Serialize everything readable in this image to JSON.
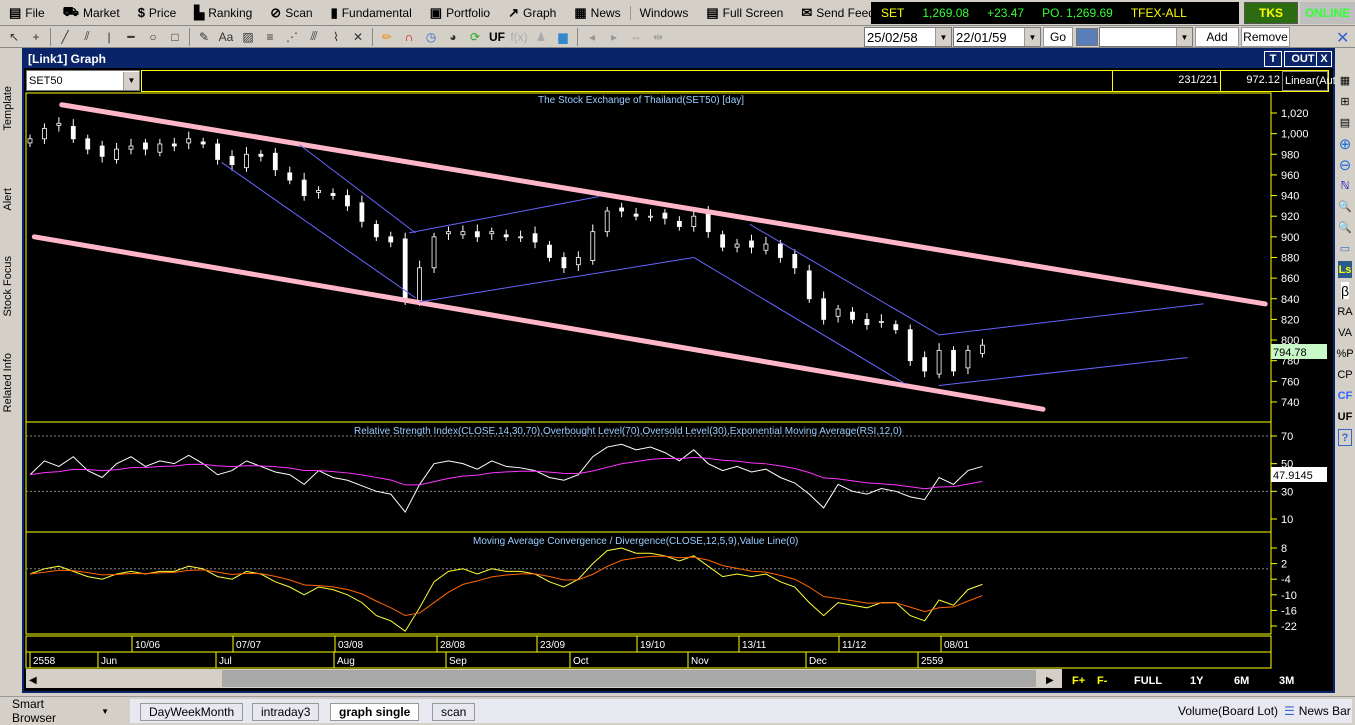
{
  "menu": [
    {
      "icon": "file-icon",
      "g": "▤",
      "label": "File"
    },
    {
      "icon": "market-icon",
      "g": "⛟",
      "label": "Market"
    },
    {
      "icon": "price-icon",
      "g": "$",
      "label": "Price"
    },
    {
      "icon": "ranking-icon",
      "g": "▙",
      "label": "Ranking"
    },
    {
      "icon": "scan-icon",
      "g": "⊘",
      "label": "Scan"
    },
    {
      "icon": "fundamental-icon",
      "g": "▮",
      "label": "Fundamental"
    },
    {
      "icon": "portfolio-icon",
      "g": "▣",
      "label": "Portfolio"
    },
    {
      "icon": "graph-icon",
      "g": "↗",
      "label": "Graph"
    },
    {
      "icon": "news-icon",
      "g": "▦",
      "label": "News"
    },
    {
      "icon": "",
      "g": "",
      "label": "Windows"
    },
    {
      "icon": "fullscreen-icon",
      "g": "▤",
      "label": "Full Screen"
    },
    {
      "icon": "feedback-icon",
      "g": "✉",
      "label": "Send Feedback"
    }
  ],
  "ticker": {
    "name": "SET",
    "value": "1,269.08",
    "change": "+23.47",
    "po": "PO. 1,269.69",
    "tfex": "TFEX-ALL",
    "colors": {
      "name": "#ffff00",
      "value": "#33ff33"
    }
  },
  "status": {
    "broker": "TKS",
    "connection": "ONLINE"
  },
  "toolbar": {
    "uf": "UF",
    "from_date": "25/02/58",
    "to_date": "22/01/59",
    "go": "Go",
    "add": "Add",
    "remove": "Remove"
  },
  "left_tabs": [
    "Template",
    "Alert",
    "Stock Focus",
    "Related Info"
  ],
  "window": {
    "title": "[Link1] Graph",
    "t_btn": "T",
    "out_btn": "OUT",
    "close_btn": "X"
  },
  "symbol": "SET50",
  "info": {
    "bars": "231/221",
    "price": "972.12",
    "scale": "Linear(Auto)"
  },
  "right_tools": [
    "RA",
    "VA",
    "%P",
    "CP",
    "CF",
    "UF"
  ],
  "chart_data": [
    {
      "type": "candlestick",
      "title": "The Stock Exchange of Thailand(SET50) [day]",
      "y_ticks": [
        "1,020",
        "1,000",
        "980",
        "960",
        "940",
        "920",
        "900",
        "880",
        "860",
        "840",
        "820",
        "800",
        "780",
        "760",
        "740"
      ],
      "ylim": [
        730,
        1030
      ],
      "last_value": "794.78",
      "close": [
        995,
        1005,
        1010,
        995,
        985,
        978,
        985,
        988,
        985,
        990,
        988,
        995,
        990,
        975,
        970,
        980,
        978,
        965,
        955,
        940,
        945,
        940,
        930,
        915,
        900,
        895,
        840,
        870,
        900,
        905,
        905,
        900,
        905,
        900,
        900,
        895,
        880,
        870,
        880,
        905,
        925,
        925,
        920,
        920,
        918,
        910,
        920,
        905,
        890,
        893,
        890,
        893,
        880,
        870,
        840,
        820,
        830,
        820,
        815,
        818,
        810,
        780,
        770,
        790,
        770,
        790,
        795
      ],
      "trendlines": [
        {
          "color": "#ffb6c8",
          "from": [
            2.2,
            1028
          ],
          "to": [
            85.6,
            835
          ]
        },
        {
          "color": "#ffb6c8",
          "from": [
            0.3,
            900
          ],
          "to": [
            70.2,
            733
          ]
        },
        {
          "color": "#6666ff",
          "from": [
            13.3,
            972
          ],
          "to": [
            26.7,
            841
          ]
        },
        {
          "color": "#6666ff",
          "from": [
            18.7,
            989
          ],
          "to": [
            26.7,
            904
          ]
        },
        {
          "color": "#6666ff",
          "from": [
            26.3,
            904
          ],
          "to": [
            39.4,
            939
          ]
        },
        {
          "color": "#6666ff",
          "from": [
            27,
            837
          ],
          "to": [
            46,
            880
          ]
        },
        {
          "color": "#6666ff",
          "from": [
            46,
            880
          ],
          "to": [
            60.6,
            758
          ]
        },
        {
          "color": "#6666ff",
          "from": [
            49.9,
            912
          ],
          "to": [
            63,
            805
          ]
        },
        {
          "color": "#6666ff",
          "from": [
            63,
            805
          ],
          "to": [
            81.3,
            835
          ]
        },
        {
          "color": "#6666ff",
          "from": [
            63,
            756
          ],
          "to": [
            80.2,
            783
          ]
        }
      ]
    },
    {
      "type": "line",
      "title": "Relative Strength Index(CLOSE,14,30,70),Overbought Level(70),Oversold Level(30),Exponential Moving Average(RSI,12,0)",
      "y_ticks": [
        "70",
        "50",
        "30",
        "10"
      ],
      "ylim": [
        0,
        80
      ],
      "levels": [
        70,
        30
      ],
      "last_value": "47.9145",
      "rsi": [
        42,
        52,
        48,
        55,
        45,
        40,
        50,
        55,
        48,
        52,
        50,
        56,
        50,
        42,
        45,
        52,
        48,
        44,
        42,
        35,
        45,
        40,
        38,
        34,
        30,
        28,
        15,
        35,
        50,
        52,
        50,
        46,
        52,
        48,
        47,
        45,
        40,
        38,
        42,
        55,
        62,
        64,
        60,
        62,
        58,
        52,
        60,
        50,
        45,
        48,
        44,
        46,
        40,
        36,
        28,
        18,
        35,
        30,
        28,
        32,
        30,
        26,
        24,
        40,
        35,
        45,
        48
      ],
      "colors": {
        "rsi": "#ffffff",
        "ema": "#ff33ff"
      }
    },
    {
      "type": "line",
      "title": "Moving Average Convergence / Divergence(CLOSE,12,5,9),Value Line(0)",
      "y_ticks": [
        "8",
        "2",
        "-4",
        "-10",
        "-16",
        "-22"
      ],
      "ylim": [
        -25,
        10
      ],
      "levels": [
        0
      ],
      "macd": [
        -2,
        0,
        1,
        -1,
        -3,
        -4,
        -2,
        -1,
        -2,
        -1,
        -1,
        1,
        0,
        -3,
        -4,
        -1,
        -2,
        -5,
        -7,
        -10,
        -7,
        -8,
        -10,
        -13,
        -18,
        -20,
        -24,
        -15,
        -5,
        -1,
        0,
        -2,
        0,
        -1,
        -1,
        -2,
        -5,
        -7,
        -4,
        2,
        7,
        8,
        6,
        6,
        5,
        3,
        5,
        1,
        -3,
        -2,
        -3,
        -2,
        -5,
        -7,
        -13,
        -18,
        -13,
        -14,
        -15,
        -13,
        -13,
        -18,
        -20,
        -12,
        -14,
        -8,
        -6
      ],
      "colors": {
        "macd": "#ffff33",
        "signal": "#ff6600"
      }
    }
  ],
  "x_axis": {
    "dates": [
      "10/06",
      "07/07",
      "03/08",
      "28/08",
      "23/09",
      "19/10",
      "13/11",
      "11/12",
      "08/01"
    ],
    "months": [
      "2558",
      "Jun",
      "Jul",
      "Aug",
      "Sep",
      "Oct",
      "Nov",
      "Dec",
      "2559"
    ]
  },
  "range_buttons": [
    "F+",
    "F-",
    "FULL",
    "1Y",
    "6M",
    "3M"
  ],
  "bottom": {
    "smart_browser": "Smart Browser",
    "tabs": [
      "DayWeekMonth",
      "intraday3",
      "graph single",
      "scan"
    ],
    "active_tab": "graph single",
    "volume": "Volume(Board Lot)",
    "newsbar": "News Bar"
  }
}
